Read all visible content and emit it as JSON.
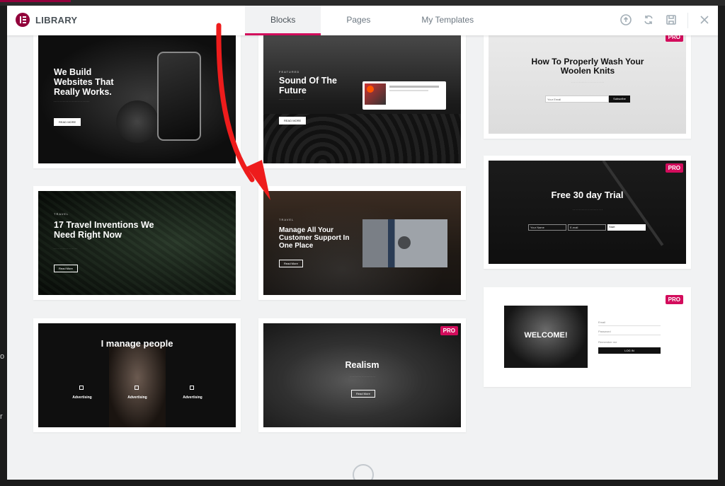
{
  "header": {
    "title": "LIBRARY",
    "tabs": [
      {
        "label": "Blocks",
        "active": true
      },
      {
        "label": "Pages",
        "active": false
      },
      {
        "label": "My Templates",
        "active": false
      }
    ],
    "icons": [
      "upload-icon",
      "sync-icon",
      "save-icon",
      "close-icon"
    ]
  },
  "colors": {
    "accent": "#d30c5c",
    "brand": "#92003b"
  },
  "backdrop": {
    "side_text_1": "o",
    "side_text_2": "r"
  },
  "cards": {
    "c1": {
      "title": "We Build Websites That Really Works.",
      "button": "READ MORE"
    },
    "c2": {
      "kicker": "FEATURED",
      "title": "Sound Of The Future",
      "button": "READ MORE"
    },
    "c3": {
      "badge": "PRO",
      "title": "How To Properly Wash Your Woolen Knits",
      "input": "Your Email",
      "button": "Subscribe"
    },
    "c4": {
      "kicker": "TRAVEL",
      "title": "17 Travel Inventions We Need Right Now",
      "button": "Read More"
    },
    "c5": {
      "kicker": "TRAVEL",
      "title": "Manage All Your Customer Support In One Place",
      "button": "Read More"
    },
    "c6": {
      "badge": "PRO",
      "title": "Free 30 day Trial",
      "field1": "Your Name",
      "field2": "E-mail",
      "button": "Start"
    },
    "c7": {
      "title": "I manage people",
      "features": [
        "Advertising",
        "Advertising",
        "Advertising"
      ]
    },
    "c8": {
      "badge": "PRO",
      "title": "Realism",
      "button": "Read More"
    },
    "c9": {
      "badge": "PRO",
      "title": "WELCOME!",
      "field1": "Email",
      "field2": "Password",
      "remember": "Remember me",
      "button": "LOG IN"
    }
  }
}
